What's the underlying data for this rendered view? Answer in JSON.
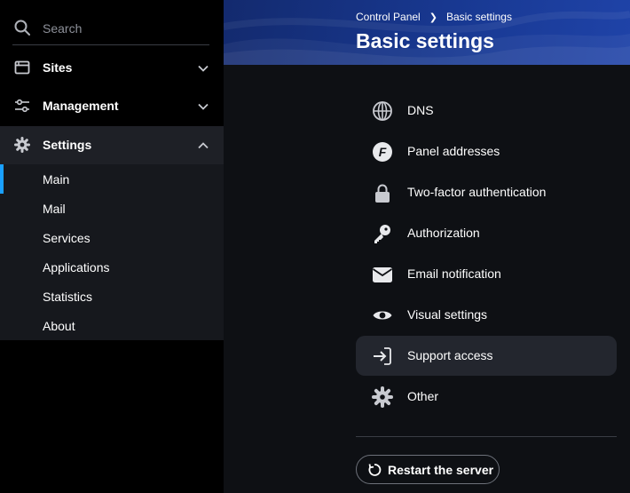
{
  "sidebar": {
    "search": {
      "placeholder": "Search"
    },
    "nav": [
      {
        "label": "Sites",
        "icon": "browser-window-icon",
        "expanded": false
      },
      {
        "label": "Management",
        "icon": "sliders-icon",
        "expanded": false
      },
      {
        "label": "Settings",
        "icon": "gear-icon",
        "expanded": true
      }
    ],
    "settings_sub": [
      {
        "label": "Main",
        "active": true
      },
      {
        "label": "Mail"
      },
      {
        "label": "Services"
      },
      {
        "label": "Applications"
      },
      {
        "label": "Statistics"
      },
      {
        "label": "About"
      }
    ]
  },
  "header": {
    "breadcrumbs": [
      "Control Panel",
      "Basic settings"
    ],
    "title": "Basic settings"
  },
  "menu": [
    {
      "label": "DNS",
      "icon": "globe-icon"
    },
    {
      "label": "Panel addresses",
      "icon": "panel-logo-icon"
    },
    {
      "label": "Two-factor authentication",
      "icon": "lock-icon"
    },
    {
      "label": "Authorization",
      "icon": "key-icon"
    },
    {
      "label": "Email notification",
      "icon": "envelope-icon"
    },
    {
      "label": "Visual settings",
      "icon": "eye-icon"
    },
    {
      "label": "Support access",
      "icon": "arrow-right-icon",
      "hovered": true
    },
    {
      "label": "Other",
      "icon": "gear-icon"
    }
  ],
  "actions": {
    "restart_label": "Restart the server"
  },
  "colors": {
    "accent": "#1aa0ff",
    "header": "#183891",
    "main_bg": "#0e1014",
    "hover_bg": "#23262e"
  }
}
